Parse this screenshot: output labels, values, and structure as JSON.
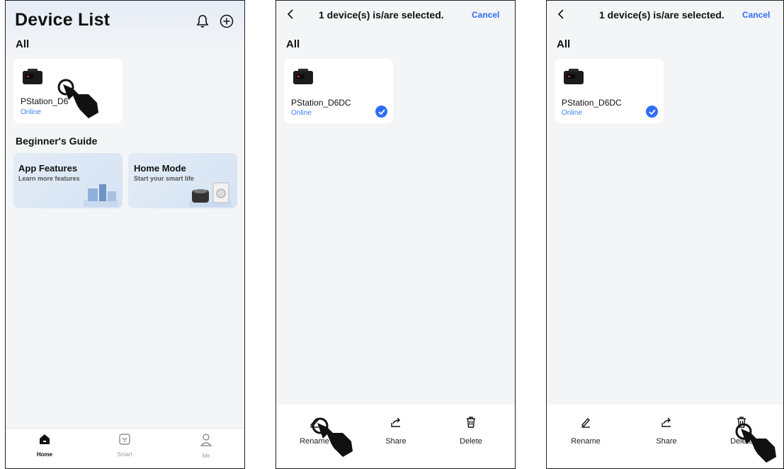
{
  "panel1": {
    "title": "Device List",
    "section_all": "All",
    "device": {
      "name": "PStation_D6",
      "status": "Online"
    },
    "guide_heading": "Beginner's Guide",
    "guides": [
      {
        "title": "App Features",
        "subtitle": "Learn more features"
      },
      {
        "title": "Home Mode",
        "subtitle": "Start your smart life"
      }
    ],
    "tabs": [
      {
        "label": "Home",
        "icon": "home-icon"
      },
      {
        "label": "Smart",
        "icon": "smart-icon"
      },
      {
        "label": "Me",
        "icon": "person-icon"
      }
    ],
    "icons": [
      "bell-icon",
      "add-circle-icon"
    ]
  },
  "panel2": {
    "nav_title": "1 device(s) is/are selected.",
    "cancel": "Cancel",
    "section_all": "All",
    "device": {
      "name": "PStation_D6DC",
      "status": "Online"
    },
    "actions": [
      {
        "label": "Rename",
        "icon": "rename-icon"
      },
      {
        "label": "Share",
        "icon": "share-icon"
      },
      {
        "label": "Delete",
        "icon": "trash-icon"
      }
    ]
  },
  "panel3": {
    "nav_title": "1 device(s) is/are selected.",
    "cancel": "Cancel",
    "section_all": "All",
    "device": {
      "name": "PStation_D6DC",
      "status": "Online"
    },
    "actions": [
      {
        "label": "Rename",
        "icon": "rename-icon"
      },
      {
        "label": "Share",
        "icon": "share-icon"
      },
      {
        "label": "Delete",
        "icon": "trash-icon"
      }
    ]
  },
  "colors": {
    "accent": "#2f6df6",
    "online": "#3b82f6",
    "background": "#f4f5f7"
  }
}
